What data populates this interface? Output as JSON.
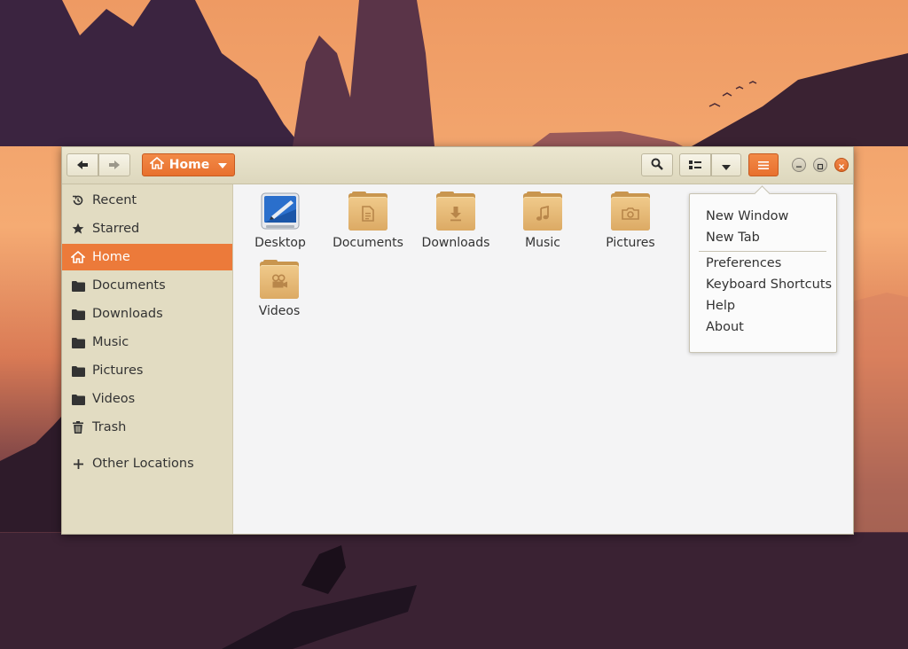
{
  "window": {
    "path_button": {
      "label": "Home"
    },
    "nav": {
      "back": "back-arrow",
      "forward": "forward-arrow"
    },
    "colors": {
      "accent": "#ec7a3a",
      "sidebar": "#e2dcc2",
      "headerbar": "#e4dfc7",
      "folder": "#e3b36e"
    }
  },
  "sidebar": {
    "items": [
      {
        "label": "Recent",
        "icon": "clock-icon"
      },
      {
        "label": "Starred",
        "icon": "star-icon"
      },
      {
        "label": "Home",
        "icon": "home-icon",
        "active": true
      },
      {
        "label": "Documents",
        "icon": "folder-icon"
      },
      {
        "label": "Downloads",
        "icon": "folder-icon"
      },
      {
        "label": "Music",
        "icon": "folder-icon"
      },
      {
        "label": "Pictures",
        "icon": "folder-icon"
      },
      {
        "label": "Videos",
        "icon": "folder-icon"
      },
      {
        "label": "Trash",
        "icon": "trash-icon"
      }
    ],
    "other_locations": {
      "label": "Other Locations",
      "icon": "plus-icon"
    }
  },
  "files": [
    {
      "label": "Desktop",
      "icon": "desktop-folder-icon"
    },
    {
      "label": "Documents",
      "icon": "documents-folder-icon"
    },
    {
      "label": "Downloads",
      "icon": "downloads-folder-icon"
    },
    {
      "label": "Music",
      "icon": "music-folder-icon"
    },
    {
      "label": "Pictures",
      "icon": "pictures-folder-icon"
    },
    {
      "label": "Videos",
      "icon": "videos-folder-icon"
    }
  ],
  "menu": {
    "items": [
      {
        "label": "New Window"
      },
      {
        "label": "New Tab"
      },
      {
        "label": "Preferences"
      },
      {
        "label": "Keyboard Shortcuts"
      },
      {
        "label": "Help"
      },
      {
        "label": "About"
      }
    ]
  }
}
